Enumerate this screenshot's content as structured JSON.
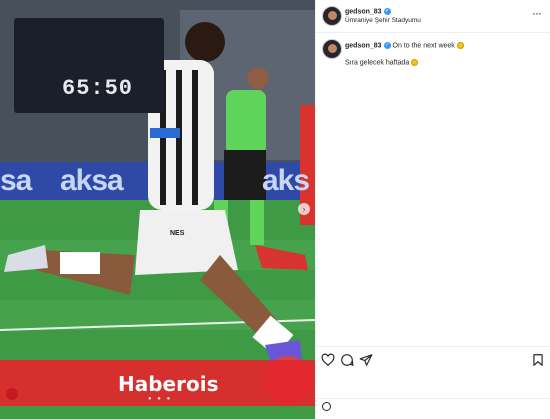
{
  "post": {
    "username": "gedson_83",
    "location": "Ümraniye Şehir Stadyumu",
    "caption_user": "gedson_83",
    "caption_line1": "On to the next week",
    "caption_line2": "Sıra gelecek haftada",
    "more_label": "···"
  },
  "photo": {
    "scoreboard_score": "65:50",
    "ad_text_left": "sa",
    "ad_text_mid": "aksa",
    "ad_text_right": "aks",
    "sponsor_chest": "NES",
    "watermark": "Haberois"
  },
  "icons": {
    "like": "heart-icon",
    "comment": "comment-icon",
    "share": "send-icon",
    "save": "bookmark-icon",
    "emoji": "smiley-icon"
  },
  "colors": {
    "verified": "#3897f0",
    "watermark_bg": "#e2262c",
    "pitch": "#3f9a45"
  }
}
